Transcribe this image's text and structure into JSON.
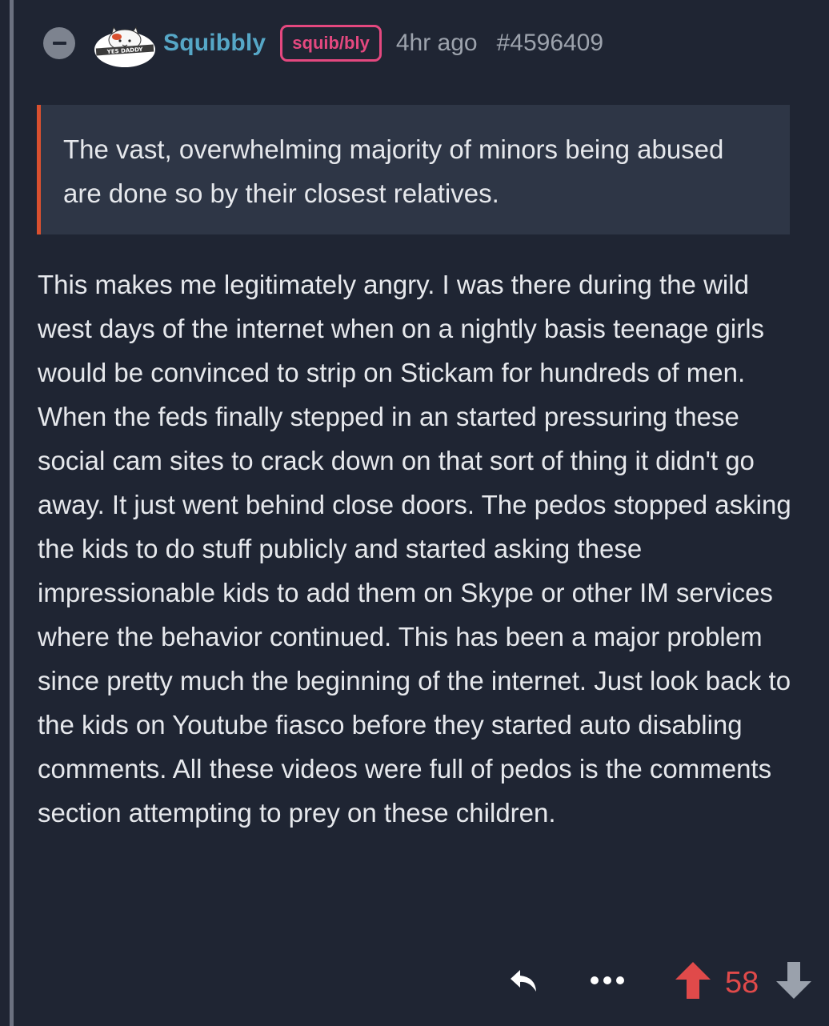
{
  "comment": {
    "username": "Squibbly",
    "flair": "squib/bly",
    "time": "4hr ago",
    "id": "#4596409",
    "avatar_text": "YES DADDY",
    "quote": "The vast, overwhelming majority of minors being abused are done so by their closest relatives.",
    "body": "This makes me legitimately angry. I was there during the wild west days of the internet when on a nightly basis teenage girls would be convinced to strip on Stickam for hundreds of men. When the feds finally stepped in an started pressuring these social cam sites to crack down on that sort of thing it didn't go away. It just went behind close doors. The pedos stopped asking the kids to do stuff publicly and started asking these impressionable kids to add them on Skype or other IM services where the behavior continued. This has been a major problem since pretty much the beginning of the internet. Just look back to the kids on Youtube fiasco before they started auto disabling comments. All these videos were full of pedos is the comments section attempting to prey on these children.",
    "score": "58"
  },
  "icons": {
    "collapse": "minus-circle-icon",
    "reply": "reply-arrow-icon",
    "more": "more-dots-icon",
    "upvote": "arrow-up-icon",
    "downvote": "arrow-down-icon"
  },
  "colors": {
    "background": "#1f2533",
    "username": "#56a7c7",
    "flair": "#e4487f",
    "quote_border": "#d9502f",
    "upvote_active": "#e04a4a",
    "muted": "#9da3ad"
  }
}
